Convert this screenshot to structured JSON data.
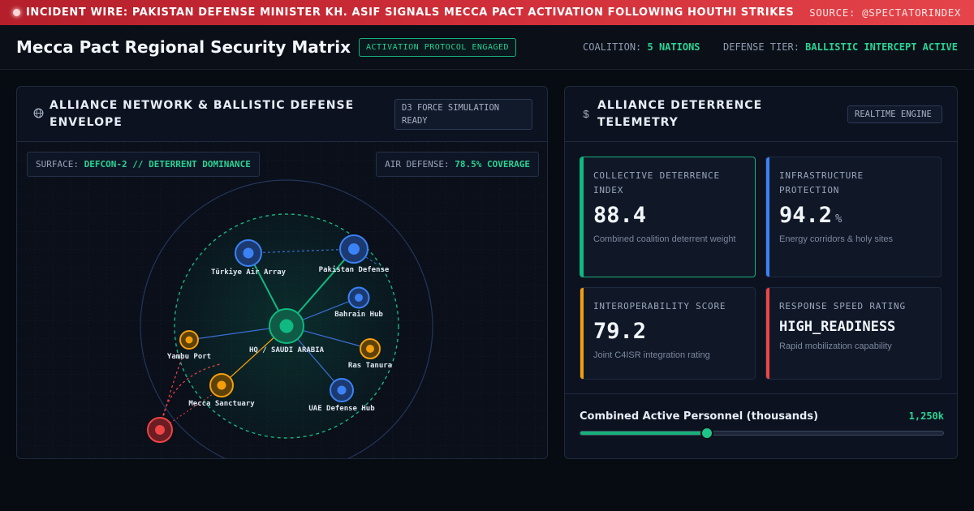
{
  "ticker": {
    "headline": "INCIDENT WIRE: PAKISTAN DEFENSE MINISTER KH. ASIF SIGNALS MECCA PACT ACTIVATION FOLLOWING HOUTHI STRIKES",
    "source": "SOURCE: @SPECTATORINDEX"
  },
  "header": {
    "title": "Mecca Pact Regional Security Matrix",
    "protocol_badge": "ACTIVATION PROTOCOL ENGAGED",
    "coalition_label": "COALITION:",
    "coalition_value": "5 NATIONS",
    "tier_label": "DEFENSE TIER:",
    "tier_value": "BALLISTIC INTERCEPT ACTIVE"
  },
  "network_panel": {
    "icon": "globe-icon",
    "title": "ALLIANCE NETWORK & BALLISTIC DEFENSE ENVELOPE",
    "status_tag": "D3 FORCE SIMULATION READY",
    "surface_label": "SURFACE:",
    "surface_value": "DEFCON-2 // DETERRENT DOMINANCE",
    "air_label": "AIR DEFENSE:",
    "air_value": "78.5% COVERAGE",
    "nodes": {
      "hq": "HQ / SAUDI ARABIA",
      "turkiye": "Türkiye Air Array",
      "pakistan": "Pakistan Defense",
      "bahrain": "Bahrain Hub",
      "ras_tanura": "Ras Tanura",
      "uae": "UAE Defense Hub",
      "mecca": "Mecca Sanctuary",
      "yanbu": "Yambu Port"
    },
    "colors": {
      "ally": "#3b82f6",
      "core": "#10b981",
      "asset": "#f59e0b",
      "threat": "#ef4444"
    }
  },
  "telemetry_panel": {
    "icon": "dollar-icon",
    "title": "ALLIANCE DETERRENCE TELEMETRY",
    "status_tag": "REALTIME ENGINE",
    "cards": [
      {
        "label": "COLLECTIVE DETERRENCE INDEX",
        "value": "88.4",
        "unit": "",
        "desc": "Combined coalition deterrent weight",
        "color": "#10b981"
      },
      {
        "label": "INFRASTRUCTURE PROTECTION",
        "value": "94.2",
        "unit": "%",
        "desc": "Energy corridors & holy sites",
        "color": "#3b82f6"
      },
      {
        "label": "INTEROPERABILITY SCORE",
        "value": "79.2",
        "unit": "",
        "desc": "Joint C4ISR integration rating",
        "color": "#f59e0b"
      },
      {
        "label": "RESPONSE SPEED RATING",
        "value": "HIGH_READINESS",
        "unit": "",
        "desc": "Rapid mobilization capability",
        "color": "#ef4444"
      }
    ],
    "personnel": {
      "label": "Combined Active Personnel (thousands)",
      "value": "1,250k",
      "level": 0.35
    }
  }
}
